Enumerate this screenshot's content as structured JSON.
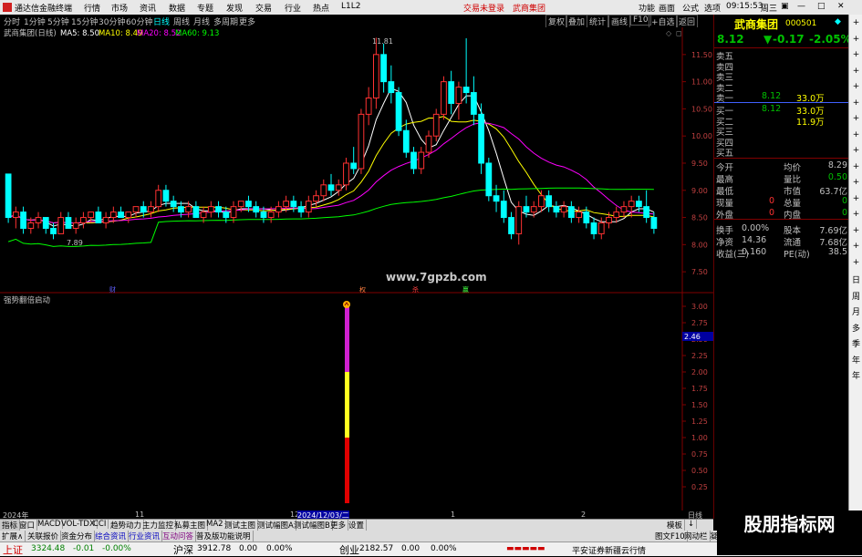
{
  "titlebar": {
    "app_name": "通达信金融终端",
    "menus": [
      "行情",
      "市场",
      "资讯",
      "数据",
      "专题",
      "发现",
      "交易",
      "行业",
      "热点",
      "L1L2"
    ],
    "center_left": "交易未登录",
    "center_right": "武商集团",
    "right_menus": [
      "功能",
      "画面",
      "公式",
      "选项"
    ],
    "time": "09:15:53",
    "weekday": "周三"
  },
  "periodbar": {
    "items": [
      "分时",
      "1分钟",
      "5分钟",
      "15分钟",
      "30分钟",
      "60分钟",
      "日线",
      "周线",
      "月线",
      "多周期",
      "更多"
    ],
    "active": "日线",
    "right_buttons": [
      "复权",
      "叠加",
      "统计",
      "画线",
      "F10",
      "+自选",
      "返回"
    ]
  },
  "main_chart": {
    "legend_title": "武商集团(日线)",
    "ma_labels": [
      {
        "text": "MA5: 8.50",
        "color": "#ffffff"
      },
      {
        "text": "MA10: 8.49",
        "color": "#ffff00"
      },
      {
        "text": "MA20: 8.52",
        "color": "#ff00ff"
      },
      {
        "text": "MA60: 9.13",
        "color": "#00ff00"
      }
    ],
    "high_label": "11.81",
    "low_label": "7.89",
    "watermark": "www.7gpzb.com",
    "y_ticks": [
      "11.50",
      "11.00",
      "10.50",
      "10.00",
      "9.50",
      "9.00",
      "8.50",
      "8.00",
      "7.50"
    ],
    "event_marks": [
      "财",
      "权",
      "杀",
      "赢"
    ]
  },
  "indicator_chart": {
    "title": "强势翻倍启动",
    "y_ticks": [
      "3.00",
      "2.75",
      "2.50",
      "2.25",
      "2.00",
      "1.75",
      "1.50",
      "1.25",
      "1.00",
      "0.75",
      "0.50",
      "0.25"
    ],
    "current_value": "2.46",
    "bar_segments": [
      {
        "from": 0,
        "to": 1.0,
        "color": "#e00000"
      },
      {
        "from": 1.0,
        "to": 2.0,
        "color": "#ffff20"
      },
      {
        "from": 2.0,
        "to": 3.0,
        "color": "#d020d0"
      }
    ]
  },
  "chart_data": {
    "type": "candlestick",
    "ylim": [
      7.2,
      11.9
    ],
    "candles": [
      [
        9.3,
        9.3,
        8.4,
        8.5
      ],
      [
        8.5,
        8.7,
        8.3,
        8.6
      ],
      [
        8.6,
        8.7,
        8.2,
        8.3
      ],
      [
        8.3,
        8.5,
        8.2,
        8.4
      ],
      [
        8.4,
        8.6,
        8.3,
        8.5
      ],
      [
        8.5,
        8.5,
        8.2,
        8.3
      ],
      [
        8.3,
        8.4,
        8.1,
        8.2
      ],
      [
        8.2,
        8.6,
        8.2,
        8.5
      ],
      [
        8.5,
        8.6,
        8.3,
        8.3
      ],
      [
        8.3,
        8.5,
        8.2,
        8.4
      ],
      [
        8.4,
        8.6,
        8.3,
        8.5
      ],
      [
        8.5,
        8.6,
        8.4,
        8.6
      ],
      [
        8.6,
        8.7,
        8.4,
        8.4
      ],
      [
        8.4,
        8.6,
        8.3,
        8.5
      ],
      [
        8.5,
        8.7,
        8.4,
        8.6
      ],
      [
        8.6,
        8.7,
        8.5,
        8.5
      ],
      [
        8.5,
        8.6,
        8.4,
        8.6
      ],
      [
        8.6,
        8.7,
        8.5,
        8.7
      ],
      [
        8.7,
        8.8,
        8.5,
        8.6
      ],
      [
        8.6,
        8.8,
        8.5,
        8.7
      ],
      [
        8.7,
        9.1,
        8.6,
        9.0
      ],
      [
        9.0,
        9.1,
        8.7,
        8.8
      ],
      [
        8.8,
        8.9,
        8.6,
        8.7
      ],
      [
        8.7,
        8.8,
        8.5,
        8.6
      ],
      [
        8.6,
        8.8,
        8.5,
        8.7
      ],
      [
        8.7,
        8.8,
        8.5,
        8.5
      ],
      [
        8.5,
        8.7,
        8.4,
        8.6
      ],
      [
        8.6,
        8.8,
        8.5,
        8.7
      ],
      [
        8.7,
        8.8,
        8.5,
        8.6
      ],
      [
        8.6,
        8.7,
        8.4,
        8.5
      ],
      [
        8.5,
        8.8,
        8.4,
        8.7
      ],
      [
        8.7,
        8.8,
        8.6,
        8.8
      ],
      [
        8.8,
        8.9,
        8.6,
        8.7
      ],
      [
        8.7,
        8.8,
        8.5,
        8.6
      ],
      [
        8.6,
        8.7,
        8.4,
        8.5
      ],
      [
        8.5,
        8.7,
        8.4,
        8.6
      ],
      [
        8.6,
        8.8,
        8.5,
        8.7
      ],
      [
        8.7,
        8.9,
        8.6,
        8.8
      ],
      [
        8.8,
        8.9,
        8.6,
        8.7
      ],
      [
        8.7,
        8.8,
        8.5,
        8.6
      ],
      [
        8.6,
        8.9,
        8.5,
        8.8
      ],
      [
        8.8,
        9.0,
        8.7,
        8.9
      ],
      [
        8.9,
        9.2,
        8.8,
        9.1
      ],
      [
        9.1,
        9.3,
        8.9,
        9.0
      ],
      [
        9.0,
        9.2,
        8.9,
        9.1
      ],
      [
        9.1,
        9.6,
        9.0,
        9.5
      ],
      [
        9.5,
        9.8,
        9.3,
        9.4
      ],
      [
        9.4,
        10.5,
        9.3,
        10.4
      ],
      [
        10.4,
        10.9,
        10.2,
        10.7
      ],
      [
        10.7,
        11.81,
        10.5,
        11.5
      ],
      [
        11.5,
        11.7,
        10.8,
        11.0
      ],
      [
        11.0,
        11.3,
        10.6,
        10.8
      ],
      [
        10.8,
        10.9,
        10.0,
        10.1
      ],
      [
        10.1,
        10.3,
        9.6,
        9.7
      ],
      [
        9.7,
        9.8,
        9.3,
        9.4
      ],
      [
        9.4,
        9.8,
        9.3,
        9.7
      ],
      [
        9.7,
        10.1,
        9.6,
        10.0
      ],
      [
        10.0,
        10.5,
        9.9,
        10.4
      ],
      [
        10.4,
        11.1,
        10.3,
        11.0
      ],
      [
        11.0,
        11.2,
        10.4,
        10.6
      ],
      [
        10.6,
        11.0,
        10.3,
        10.9
      ],
      [
        10.9,
        11.8,
        10.6,
        10.8
      ],
      [
        10.8,
        11.1,
        10.2,
        10.4
      ],
      [
        10.4,
        10.6,
        9.3,
        9.5
      ],
      [
        9.5,
        9.6,
        8.8,
        8.9
      ],
      [
        8.9,
        9.1,
        8.6,
        8.8
      ],
      [
        8.8,
        9.0,
        8.4,
        8.5
      ],
      [
        8.5,
        8.6,
        8.1,
        8.2
      ],
      [
        8.2,
        8.8,
        8.0,
        8.7
      ],
      [
        8.7,
        8.9,
        8.5,
        8.6
      ],
      [
        8.6,
        8.8,
        8.5,
        8.7
      ],
      [
        8.7,
        9.0,
        8.6,
        8.9
      ],
      [
        8.9,
        9.0,
        8.6,
        8.7
      ],
      [
        8.7,
        8.8,
        8.5,
        8.6
      ],
      [
        8.6,
        8.8,
        8.5,
        8.7
      ],
      [
        8.7,
        8.8,
        8.4,
        8.5
      ],
      [
        8.5,
        8.7,
        8.4,
        8.6
      ],
      [
        8.6,
        8.7,
        8.3,
        8.4
      ],
      [
        8.4,
        8.5,
        8.1,
        8.2
      ],
      [
        8.2,
        8.5,
        8.1,
        8.4
      ],
      [
        8.4,
        8.6,
        8.3,
        8.5
      ],
      [
        8.5,
        8.7,
        8.4,
        8.6
      ],
      [
        8.6,
        8.8,
        8.5,
        8.7
      ],
      [
        8.7,
        8.9,
        8.5,
        8.8
      ],
      [
        8.8,
        8.9,
        8.6,
        8.7
      ],
      [
        8.7,
        9.0,
        8.4,
        8.5
      ],
      [
        8.5,
        8.6,
        8.2,
        8.3
      ]
    ]
  },
  "axis_labels": {
    "x": [
      "2024年",
      "11",
      "12",
      "2024/12/03/二",
      "1",
      "2"
    ],
    "period": "日线"
  },
  "quote": {
    "name": "武商集团",
    "code": "000501",
    "price": "8.12",
    "change": "-0.17",
    "change_pct": "-2.05%",
    "asks": [
      {
        "label": "卖五",
        "price": "",
        "vol": ""
      },
      {
        "label": "卖四",
        "price": "",
        "vol": ""
      },
      {
        "label": "卖三",
        "price": "",
        "vol": ""
      },
      {
        "label": "卖二",
        "price": "",
        "vol": ""
      },
      {
        "label": "卖一",
        "price": "8.12",
        "vol": "33.0万"
      }
    ],
    "bids": [
      {
        "label": "买一",
        "price": "8.12",
        "vol": "33.0万"
      },
      {
        "label": "买二",
        "price": "",
        "vol": "11.9万"
      },
      {
        "label": "买三",
        "price": "",
        "vol": ""
      },
      {
        "label": "买四",
        "price": "",
        "vol": ""
      },
      {
        "label": "买五",
        "price": "",
        "vol": ""
      }
    ],
    "stats": [
      [
        "今开",
        "",
        "均价",
        "8.29"
      ],
      [
        "最高",
        "",
        "量比",
        "0.50"
      ],
      [
        "最低",
        "",
        "市值",
        "63.7亿"
      ],
      [
        "现量",
        "0",
        "总量",
        "0"
      ],
      [
        "外盘",
        "0",
        "内盘",
        "0"
      ],
      [
        "换手",
        "0.00%",
        "股本",
        "7.69亿"
      ],
      [
        "净资",
        "14.36",
        "流通",
        "7.68亿"
      ],
      [
        "收益(三)",
        "0.160",
        "PE(动)",
        "38.5"
      ]
    ]
  },
  "sidenav": [
    "+",
    "+",
    "+",
    "+",
    "+",
    "+",
    "+",
    "+",
    "+",
    "+",
    "+",
    "+",
    "+",
    "+",
    "+",
    "+",
    "日",
    "周",
    "月",
    "多",
    "季",
    "年",
    "年"
  ],
  "tabs1": [
    "指标",
    "窗口",
    "MACD",
    "VOL-TDX",
    "CCI",
    "趋势动力",
    "主力监控",
    "私募主图",
    "MA2",
    "测试主图",
    "测试幅图A",
    "测试幅图B",
    "更多",
    "设置"
  ],
  "tabs1_right": [
    "模板",
    "↓"
  ],
  "tabs2": [
    "扩展∧",
    "关联报价",
    "资金分布",
    "综合资讯",
    "行业资讯",
    "互动问答",
    "普及版功能说明"
  ],
  "tabs2_right": [
    "图文F10",
    "网动栏",
    "凝"
  ],
  "statusbar": {
    "sh_label": "上证",
    "sh_value": "3324.48",
    "sh_change": "-0.01",
    "sh_pct": "-0.00%",
    "sz_label": "沪深",
    "sz_value": "3912.78",
    "sz_change": "0.00",
    "sz_pct": "0.00%",
    "cy_label": "创业",
    "cy_value": "2182.57",
    "cy_change": "0.00",
    "cy_pct": "0.00%",
    "broker": "平安证券新疆云行情"
  },
  "corner_watermark": "股朋指标网"
}
